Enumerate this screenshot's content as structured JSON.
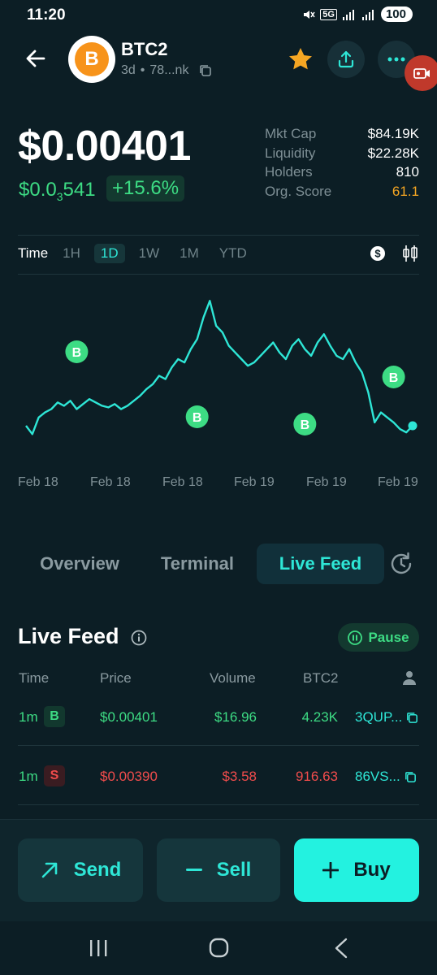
{
  "status": {
    "time": "11:20",
    "network": "5G",
    "battery": "100"
  },
  "header": {
    "token_symbol_icon": "B",
    "token_name": "BTC2",
    "age": "3d",
    "address_short": "78...nk",
    "icons": [
      "back-arrow-icon",
      "bitcoin-logo",
      "copy-icon",
      "star-icon",
      "share-icon",
      "more-icon",
      "screen-record-icon"
    ]
  },
  "price": {
    "main": "$0.00401",
    "sub_prefix": "$0.0",
    "sub_zero_count": "3",
    "sub_suffix": "541",
    "change": "+15.6%"
  },
  "stats": [
    {
      "label": "Mkt Cap",
      "value": "$84.19K"
    },
    {
      "label": "Liquidity",
      "value": "$22.28K"
    },
    {
      "label": "Holders",
      "value": "810"
    },
    {
      "label": "Org. Score",
      "value": "61.1"
    }
  ],
  "time_tabs": {
    "label": "Time",
    "items": [
      "1H",
      "1D",
      "1W",
      "1M",
      "YTD"
    ],
    "active": "1D"
  },
  "chart_data": {
    "type": "line",
    "x": [
      "Feb 18",
      "Feb 18",
      "Feb 18",
      "Feb 19",
      "Feb 19",
      "Feb 19"
    ],
    "xlabels": [
      "Feb 18",
      "Feb 18",
      "Feb 18",
      "Feb 19",
      "Feb 19",
      "Feb 19"
    ],
    "series": [
      {
        "values": [
          0.2,
          0.15,
          0.25,
          0.28,
          0.3,
          0.34,
          0.32,
          0.35,
          0.3,
          0.33,
          0.36,
          0.34,
          0.32,
          0.31,
          0.33,
          0.3,
          0.32,
          0.35,
          0.38,
          0.42,
          0.45,
          0.5,
          0.48,
          0.55,
          0.6,
          0.58,
          0.66,
          0.72,
          0.85,
          0.95,
          0.8,
          0.76,
          0.68,
          0.64,
          0.6,
          0.56,
          0.58,
          0.62,
          0.66,
          0.7,
          0.64,
          0.6,
          0.68,
          0.72,
          0.66,
          0.62,
          0.7,
          0.75,
          0.68,
          0.62,
          0.6,
          0.66,
          0.58,
          0.52,
          0.4,
          0.22,
          0.28,
          0.25,
          0.22,
          0.18,
          0.16,
          0.2
        ]
      }
    ],
    "trade_markers": [
      {
        "label": "B",
        "x_index": 8
      },
      {
        "label": "B",
        "x_index": 27
      },
      {
        "label": "B",
        "x_index": 44
      },
      {
        "label": "B",
        "x_index": 58
      }
    ],
    "color": "#2ee6d6"
  },
  "main_tabs": {
    "items": [
      "Overview",
      "Terminal",
      "Live Feed"
    ],
    "active": "Live Feed"
  },
  "live_feed": {
    "title": "Live Feed",
    "pause_label": "Pause",
    "columns": [
      "Time",
      "Price",
      "Volume",
      "BTC2"
    ],
    "rows": [
      {
        "time": "1m",
        "side": "B",
        "price": "$0.00401",
        "volume": "$16.96",
        "amount": "4.23K",
        "trader": "3QUP..."
      },
      {
        "time": "1m",
        "side": "S",
        "price": "$0.00390",
        "volume": "$3.58",
        "amount": "916.63",
        "trader": "86VS..."
      }
    ]
  },
  "actions": {
    "send": "Send",
    "sell": "Sell",
    "buy": "Buy"
  }
}
